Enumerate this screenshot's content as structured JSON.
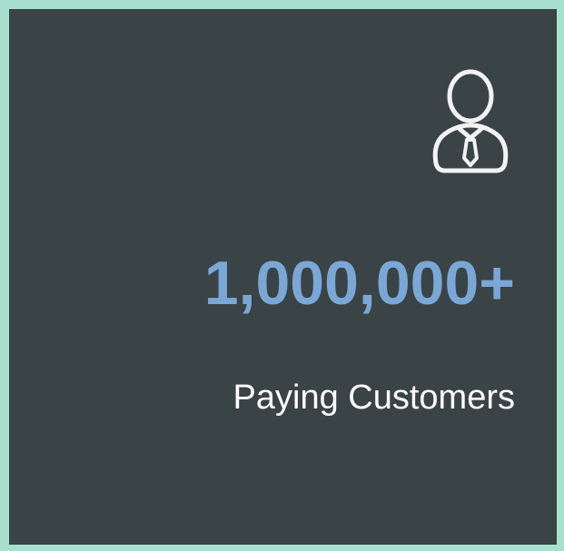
{
  "stat_card": {
    "icon": "user-business-icon",
    "value": "1,000,000+",
    "label": "Paying Customers"
  },
  "colors": {
    "page_border": "#a8e0cf",
    "card_background": "#3a4345",
    "value_text": "#7aa7d6",
    "label_text": "#ffffff",
    "icon_stroke": "#f2f2f2"
  }
}
